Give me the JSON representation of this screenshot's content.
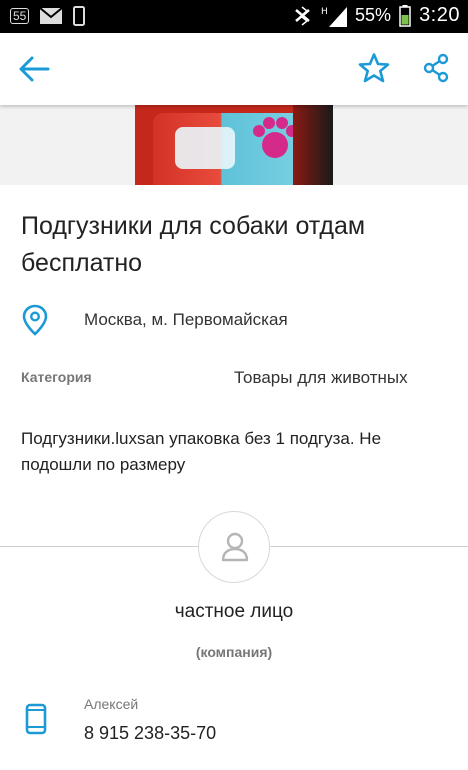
{
  "status_bar": {
    "notification_badge": "55",
    "battery_percent": "55%",
    "time": "3:20",
    "icons": [
      "mail-icon",
      "phone-icon",
      "bluetooth-icon",
      "signal-icon",
      "battery-icon"
    ]
  },
  "toolbar": {
    "back_icon": "arrow-left-icon",
    "favorite_icon": "star-outline-icon",
    "share_icon": "share-icon",
    "accent_color": "#1b9ad6"
  },
  "listing": {
    "title": "Подгузники для собаки отдам бесплатно",
    "location": "Москва, м. Первомайская",
    "category_label": "Категория",
    "category_value": "Товары для животных",
    "description": "Подгузники.luxsan упаковка без 1 подгуза. Не подошли по размеру"
  },
  "seller": {
    "name": "частное лицо",
    "type": "(компания)",
    "contact_name": "Алексей",
    "phone": "8 915 238-35-70"
  }
}
